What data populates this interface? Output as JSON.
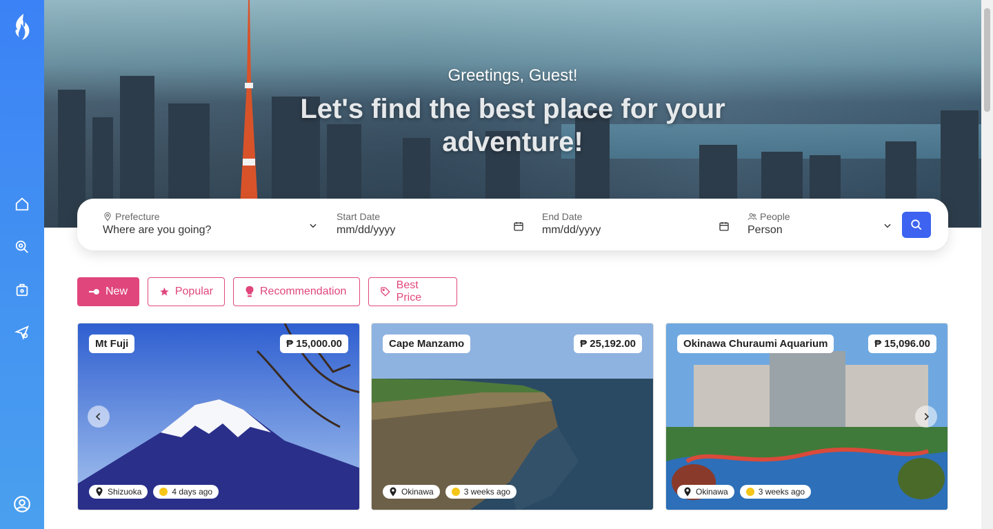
{
  "hero": {
    "greeting": "Greetings, Guest!",
    "headline": "Let's find the best place for your adventure!"
  },
  "search": {
    "prefecture": {
      "label": "Prefecture",
      "placeholder": "Where are you going?"
    },
    "start_date": {
      "label": "Start Date",
      "placeholder": "mm/dd/yyyy"
    },
    "end_date": {
      "label": "End Date",
      "placeholder": "mm/dd/yyyy"
    },
    "people": {
      "label": "People",
      "placeholder": "Person"
    }
  },
  "filters": [
    {
      "label": "New",
      "icon": "toggle-icon",
      "active": true
    },
    {
      "label": "Popular",
      "icon": "star-icon",
      "active": false
    },
    {
      "label": "Recommendation",
      "icon": "lightbulb-icon",
      "active": false
    },
    {
      "label": "Best Price",
      "icon": "tag-icon",
      "active": false
    }
  ],
  "cards": [
    {
      "title": "Mt Fuji",
      "price": "₱ 15,000.00",
      "location": "Shizuoka",
      "time": "4 days ago"
    },
    {
      "title": "Cape Manzamo",
      "price": "₱ 25,192.00",
      "location": "Okinawa",
      "time": "3 weeks ago"
    },
    {
      "title": "Okinawa Churaumi Aquarium",
      "price": "₱ 15,096.00",
      "location": "Okinawa",
      "time": "3 weeks ago"
    }
  ],
  "colors": {
    "accent": "#e0467c",
    "primary": "#3d63f0",
    "sidebar": "#3b82f6"
  }
}
